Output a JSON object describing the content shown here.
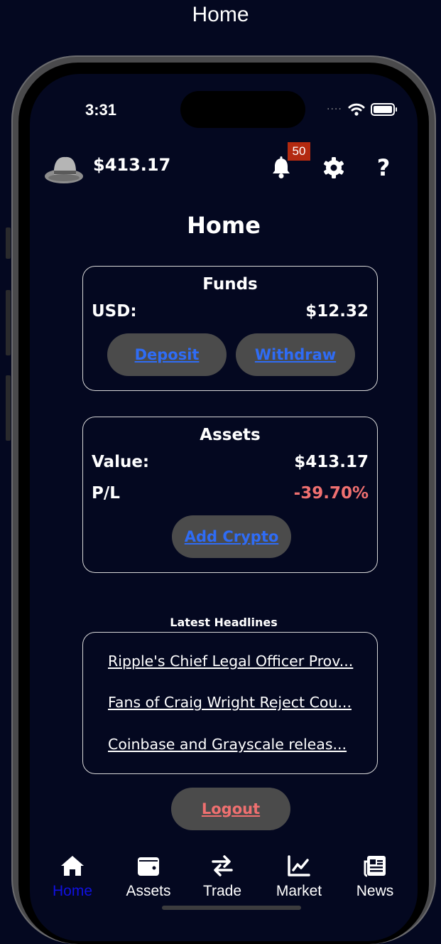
{
  "frame_title": "Home",
  "status_bar": {
    "time": "3:31",
    "signal": "····"
  },
  "topbar": {
    "balance": "$413.17",
    "notification_count": "50",
    "help_label": "?"
  },
  "page_title": "Home",
  "funds": {
    "title": "Funds",
    "currency_label": "USD:",
    "amount": "$12.32",
    "deposit_label": "Deposit",
    "withdraw_label": "Withdraw"
  },
  "assets": {
    "title": "Assets",
    "value_label": "Value:",
    "value": "$413.17",
    "pl_label": "P/L",
    "pl_value": "-39.70%",
    "pl_color": "#f07070",
    "add_label": "Add Crypto"
  },
  "headlines": {
    "label": "Latest Headlines",
    "items": [
      "Ripple's Chief Legal Officer Prov...",
      "Fans of Craig Wright Reject Cou...",
      "Coinbase and Grayscale releas..."
    ]
  },
  "logout_label": "Logout",
  "tabs": [
    {
      "label": "Home",
      "icon": "home-icon",
      "active": true
    },
    {
      "label": "Assets",
      "icon": "wallet-icon",
      "active": false
    },
    {
      "label": "Trade",
      "icon": "swap-arrows-icon",
      "active": false
    },
    {
      "label": "Market",
      "icon": "line-chart-icon",
      "active": false
    },
    {
      "label": "News",
      "icon": "newspaper-icon",
      "active": false
    }
  ],
  "colors": {
    "background": "#040820",
    "link_blue": "#2f6cf5",
    "active_tab": "#1010e0",
    "badge": "#b32a10",
    "pill": "#4b4b4b"
  }
}
